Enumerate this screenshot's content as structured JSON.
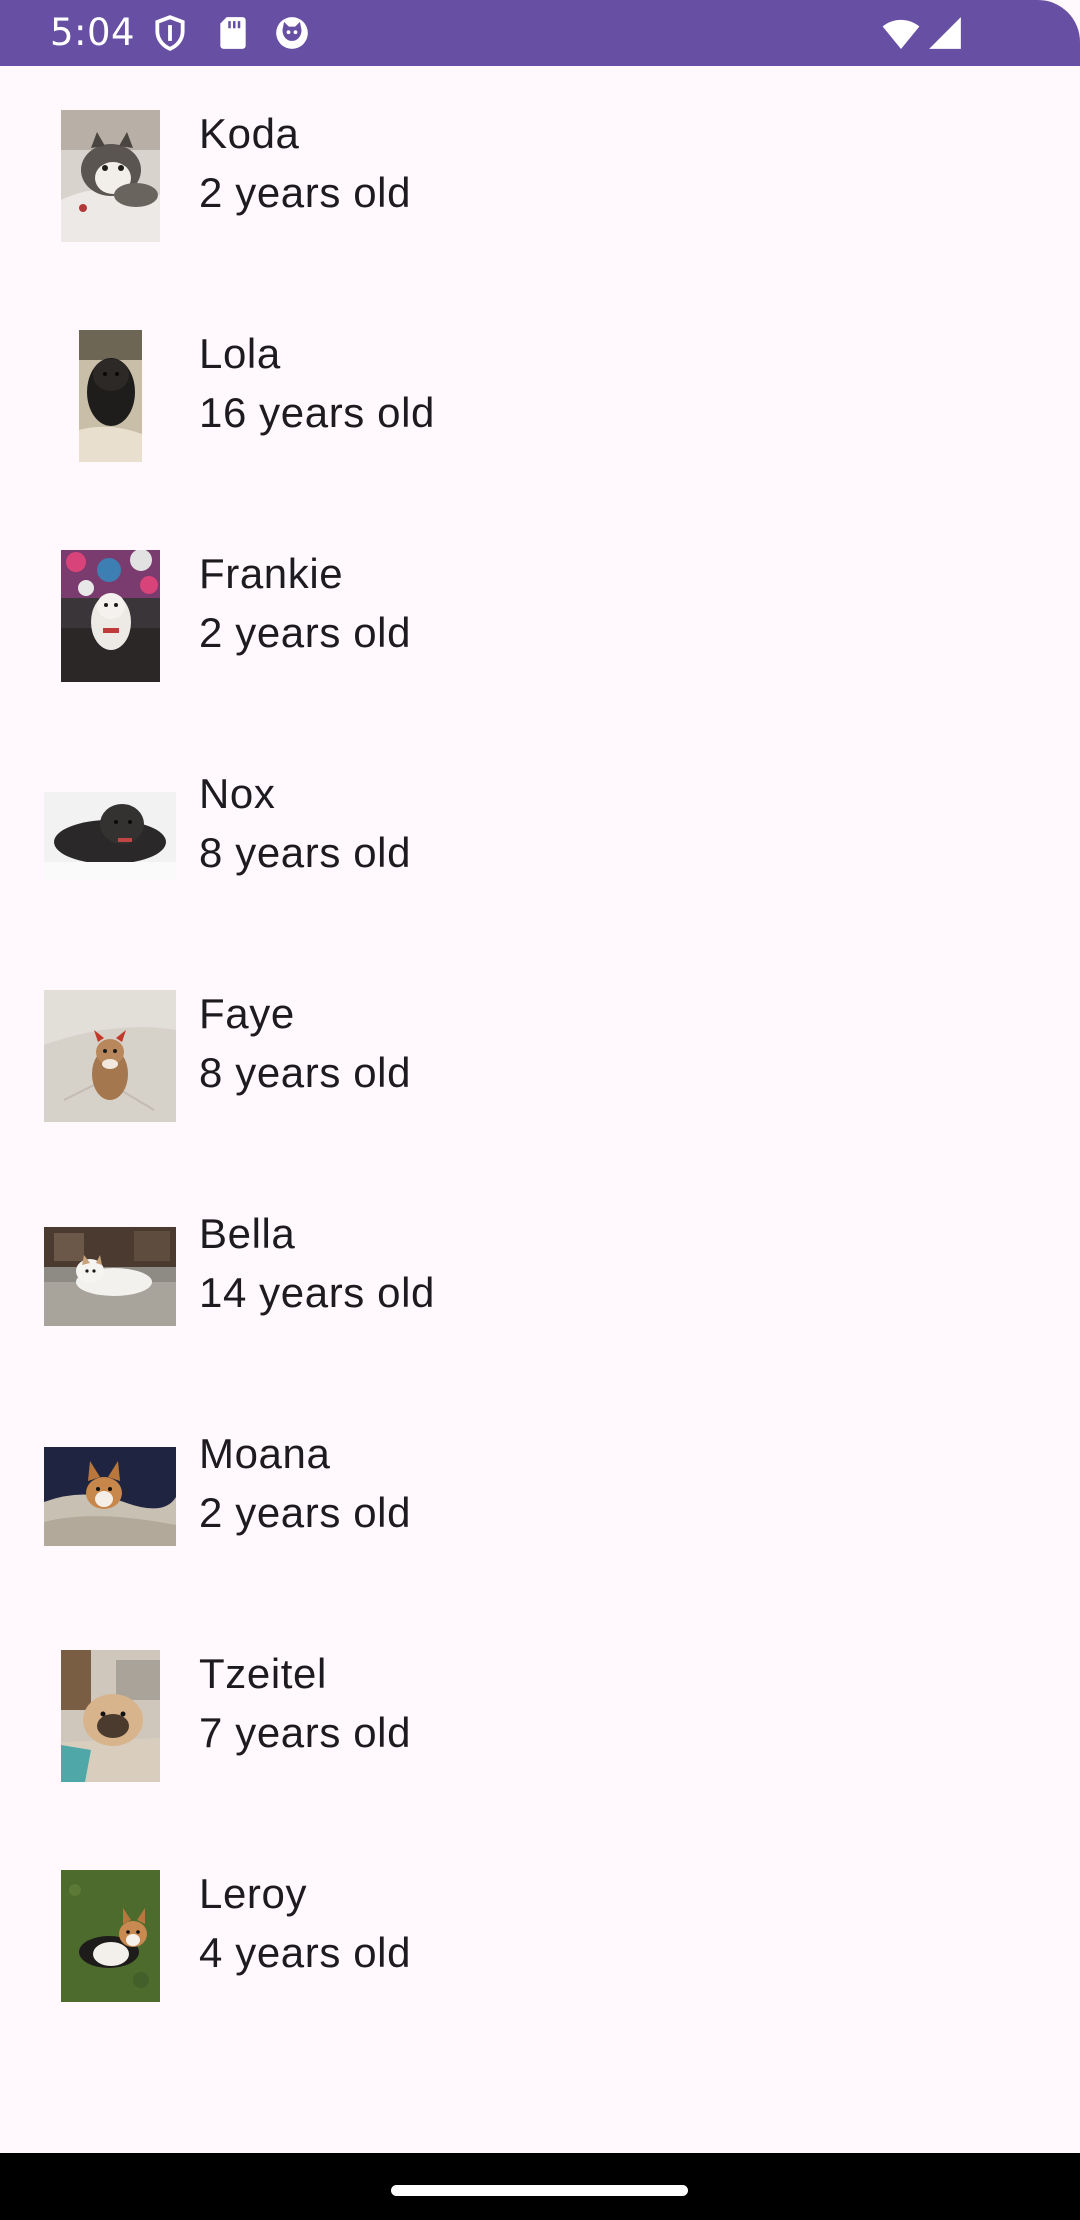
{
  "status_bar": {
    "time": "5:04",
    "background": "#6750A4",
    "icons": [
      "shield-icon",
      "sd-card-icon",
      "cat-face-icon",
      "wifi-icon",
      "signal-icon"
    ]
  },
  "pets": [
    {
      "name": "Koda",
      "age": "2 years old",
      "photo": "photo-koda-husky-on-bed"
    },
    {
      "name": "Lola",
      "age": "16 years old",
      "photo": "photo-lola-black-dog"
    },
    {
      "name": "Frankie",
      "age": "2 years old",
      "photo": "photo-frankie-dog-colorful-background"
    },
    {
      "name": "Nox",
      "age": "8 years old",
      "photo": "photo-nox-black-dog-lying"
    },
    {
      "name": "Faye",
      "age": "8 years old",
      "photo": "photo-faye-dog-with-bow"
    },
    {
      "name": "Bella",
      "age": "14 years old",
      "photo": "photo-bella-white-dog-on-gravel"
    },
    {
      "name": "Moana",
      "age": "2 years old",
      "photo": "photo-moana-corgi-on-blanket"
    },
    {
      "name": "Tzeitel",
      "age": "7 years old",
      "photo": "photo-tzeitel-pug-on-cushion"
    },
    {
      "name": "Leroy",
      "age": "4 years old",
      "photo": "photo-leroy-corgi-on-grass"
    }
  ],
  "navigation_bar": {
    "background": "#000000",
    "handle": "home-gesture-handle"
  }
}
